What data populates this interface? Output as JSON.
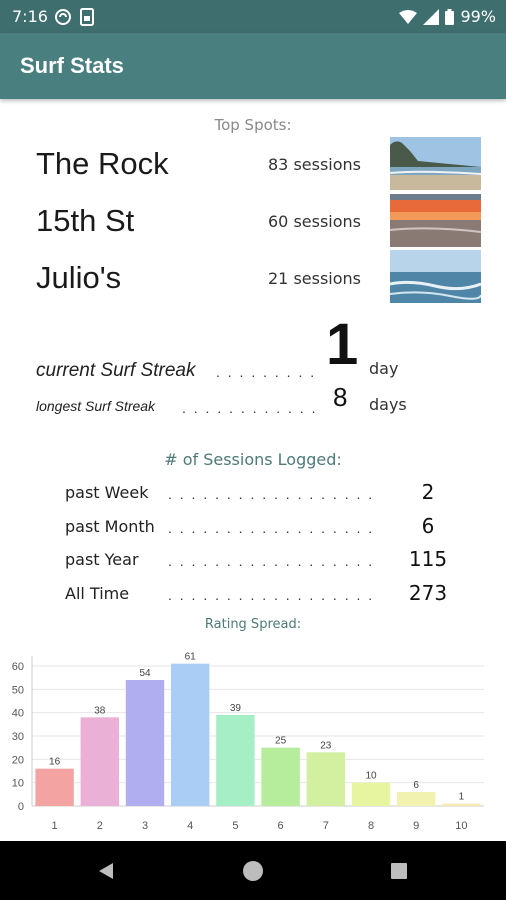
{
  "status_bar": {
    "time": "7:16",
    "battery": "99%",
    "icons": [
      "sync-icon",
      "sim-icon",
      "wifi-icon",
      "signal-icon",
      "battery-icon"
    ]
  },
  "app_bar": {
    "title": "Surf Stats"
  },
  "top_spots": {
    "label": "Top Spots:",
    "spots": [
      {
        "name": "The Rock",
        "sessions": "83 sessions"
      },
      {
        "name": "15th St",
        "sessions": "60 sessions"
      },
      {
        "name": "Julio's",
        "sessions": "21 sessions"
      }
    ]
  },
  "streak": {
    "current_label": "current Surf Streak",
    "current_value": "1",
    "current_unit": "day",
    "longest_label": "longest Surf Streak",
    "longest_value": "8",
    "longest_unit": "days"
  },
  "sessions_logged": {
    "label": "# of Sessions Logged:",
    "rows": [
      {
        "label": "past Week",
        "value": "2"
      },
      {
        "label": "past Month",
        "value": "6"
      },
      {
        "label": "past Year",
        "value": "115"
      },
      {
        "label": "All Time",
        "value": "273"
      }
    ]
  },
  "rating_spread": {
    "label": "Rating Spread:"
  },
  "chart_data": {
    "type": "bar",
    "title": "Rating Spread:",
    "categories": [
      "1",
      "2",
      "3",
      "4",
      "5",
      "6",
      "7",
      "8",
      "9",
      "10"
    ],
    "values": [
      16,
      38,
      54,
      61,
      39,
      25,
      23,
      10,
      6,
      1
    ],
    "ylim": [
      0,
      60
    ],
    "yticks": [
      "0",
      "10",
      "20",
      "30",
      "40",
      "50",
      "60"
    ],
    "grid": true,
    "colors": [
      "#f4a3a3",
      "#eab0d6",
      "#b0aef0",
      "#a9cdf5",
      "#a6efc6",
      "#b6ed9c",
      "#d2f0a0",
      "#e7f5a0",
      "#f2f2b0",
      "#f6eab4"
    ]
  },
  "nav_bar": {
    "icons": [
      "back-icon",
      "home-icon",
      "recents-icon"
    ]
  }
}
